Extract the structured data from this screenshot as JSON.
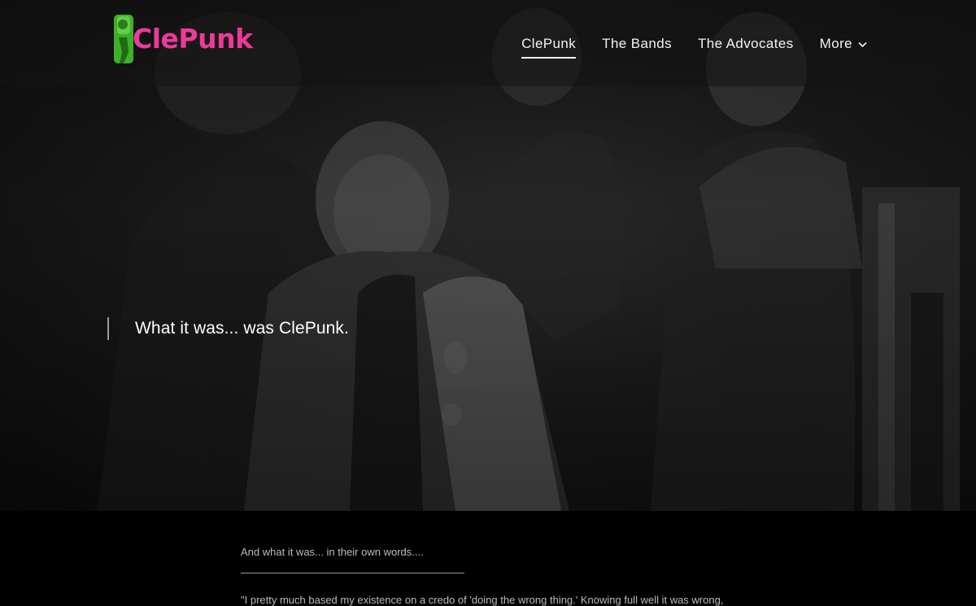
{
  "brand": {
    "name": "ClePunk",
    "accent_color": "#ec3a9a",
    "logo_icon_color": "#3fae2a"
  },
  "nav": {
    "items": [
      {
        "label": "ClePunk",
        "active": true
      },
      {
        "label": "The Bands",
        "active": false
      },
      {
        "label": "The Advocates",
        "active": false
      },
      {
        "label": "More",
        "active": false,
        "icon": "chevron-down-icon"
      }
    ]
  },
  "hero": {
    "quote": "What it was... was ClePunk."
  },
  "content": {
    "intro": "And what it was... in their own words....",
    "quote_start": "\"I pretty much based my existence on a credo of 'doing the wrong thing.' Knowing full well it was wrong,"
  }
}
